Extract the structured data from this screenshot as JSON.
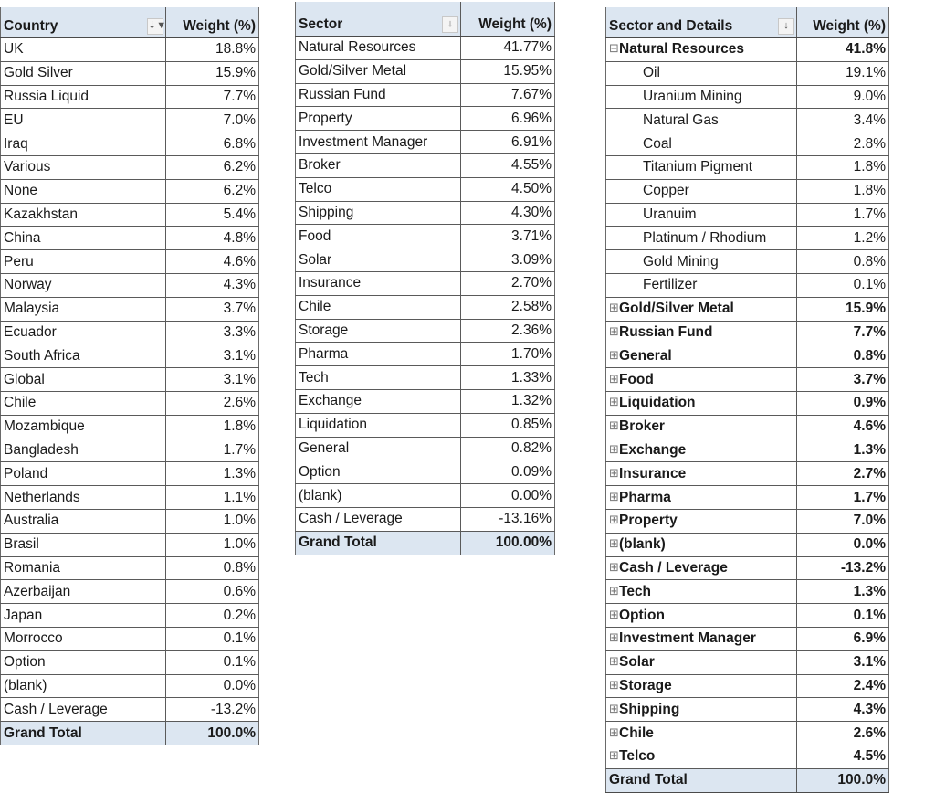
{
  "country_table": {
    "header": {
      "label": "Country",
      "value": "Weight (%)",
      "filter_icon": "filter-sort-icon"
    },
    "rows": [
      {
        "label": "UK",
        "value": "18.8%"
      },
      {
        "label": "Gold Silver",
        "value": "15.9%"
      },
      {
        "label": "Russia Liquid",
        "value": "7.7%"
      },
      {
        "label": "EU",
        "value": "7.0%"
      },
      {
        "label": "Iraq",
        "value": "6.8%"
      },
      {
        "label": "Various",
        "value": "6.2%"
      },
      {
        "label": "None",
        "value": "6.2%"
      },
      {
        "label": "Kazakhstan",
        "value": "5.4%"
      },
      {
        "label": "China",
        "value": "4.8%"
      },
      {
        "label": "Peru",
        "value": "4.6%"
      },
      {
        "label": "Norway",
        "value": "4.3%"
      },
      {
        "label": "Malaysia",
        "value": "3.7%"
      },
      {
        "label": "Ecuador",
        "value": "3.3%"
      },
      {
        "label": "South Africa",
        "value": "3.1%"
      },
      {
        "label": "Global",
        "value": "3.1%"
      },
      {
        "label": "Chile",
        "value": "2.6%"
      },
      {
        "label": "Mozambique",
        "value": "1.8%"
      },
      {
        "label": "Bangladesh",
        "value": "1.7%"
      },
      {
        "label": "Poland",
        "value": "1.3%"
      },
      {
        "label": "Netherlands",
        "value": "1.1%"
      },
      {
        "label": "Australia",
        "value": "1.0%"
      },
      {
        "label": "Brasil",
        "value": "1.0%"
      },
      {
        "label": "Romania",
        "value": "0.8%"
      },
      {
        "label": "Azerbaijan",
        "value": "0.6%"
      },
      {
        "label": "Japan",
        "value": "0.2%"
      },
      {
        "label": "Morrocco",
        "value": "0.1%"
      },
      {
        "label": "Option",
        "value": "0.1%"
      },
      {
        "label": "(blank)",
        "value": "0.0%"
      },
      {
        "label": "Cash / Leverage",
        "value": "-13.2%"
      }
    ],
    "total": {
      "label": "Grand Total",
      "value": "100.0%"
    }
  },
  "sector_table": {
    "header": {
      "label": "Sector",
      "value": "Weight (%)",
      "filter_icon": "sort-descending-icon"
    },
    "rows": [
      {
        "label": "Natural Resources",
        "value": "41.77%"
      },
      {
        "label": "Gold/Silver Metal",
        "value": "15.95%"
      },
      {
        "label": "Russian Fund",
        "value": "7.67%"
      },
      {
        "label": "Property",
        "value": "6.96%"
      },
      {
        "label": "Investment Manager",
        "value": "6.91%"
      },
      {
        "label": "Broker",
        "value": "4.55%"
      },
      {
        "label": "Telco",
        "value": "4.50%"
      },
      {
        "label": "Shipping",
        "value": "4.30%"
      },
      {
        "label": "Food",
        "value": "3.71%"
      },
      {
        "label": "Solar",
        "value": "3.09%"
      },
      {
        "label": "Insurance",
        "value": "2.70%"
      },
      {
        "label": "Chile",
        "value": "2.58%"
      },
      {
        "label": "Storage",
        "value": "2.36%"
      },
      {
        "label": "Pharma",
        "value": "1.70%"
      },
      {
        "label": "Tech",
        "value": "1.33%"
      },
      {
        "label": "Exchange",
        "value": "1.32%"
      },
      {
        "label": "Liquidation",
        "value": "0.85%"
      },
      {
        "label": "General",
        "value": "0.82%"
      },
      {
        "label": "Option",
        "value": "0.09%"
      },
      {
        "label": "(blank)",
        "value": "0.00%"
      },
      {
        "label": "Cash / Leverage",
        "value": "-13.16%"
      }
    ],
    "total": {
      "label": "Grand Total",
      "value": "100.00%"
    }
  },
  "detail_table": {
    "header": {
      "label": "Sector and Details",
      "value": "Weight (%)",
      "filter_icon": "sort-descending-icon"
    },
    "groups": [
      {
        "label": "Natural Resources",
        "value": "41.8%",
        "expanded": true,
        "children": [
          {
            "label": "Oil",
            "value": "19.1%"
          },
          {
            "label": "Uranium Mining",
            "value": "9.0%"
          },
          {
            "label": "Natural Gas",
            "value": "3.4%"
          },
          {
            "label": "Coal",
            "value": "2.8%"
          },
          {
            "label": "Titanium Pigment",
            "value": "1.8%"
          },
          {
            "label": "Copper",
            "value": "1.8%"
          },
          {
            "label": "Uranuim",
            "value": "1.7%"
          },
          {
            "label": "Platinum / Rhodium",
            "value": "1.2%"
          },
          {
            "label": "Gold Mining",
            "value": "0.8%"
          },
          {
            "label": "Fertilizer",
            "value": "0.1%"
          }
        ]
      },
      {
        "label": "Gold/Silver Metal",
        "value": "15.9%",
        "expanded": false
      },
      {
        "label": "Russian Fund",
        "value": "7.7%",
        "expanded": false
      },
      {
        "label": "General",
        "value": "0.8%",
        "expanded": false
      },
      {
        "label": "Food",
        "value": "3.7%",
        "expanded": false
      },
      {
        "label": "Liquidation",
        "value": "0.9%",
        "expanded": false
      },
      {
        "label": "Broker",
        "value": "4.6%",
        "expanded": false
      },
      {
        "label": "Exchange",
        "value": "1.3%",
        "expanded": false
      },
      {
        "label": "Insurance",
        "value": "2.7%",
        "expanded": false
      },
      {
        "label": "Pharma",
        "value": "1.7%",
        "expanded": false
      },
      {
        "label": "Property",
        "value": "7.0%",
        "expanded": false
      },
      {
        "label": "(blank)",
        "value": "0.0%",
        "expanded": false
      },
      {
        "label": "Cash / Leverage",
        "value": "-13.2%",
        "expanded": false
      },
      {
        "label": "Tech",
        "value": "1.3%",
        "expanded": false
      },
      {
        "label": "Option",
        "value": "0.1%",
        "expanded": false
      },
      {
        "label": "Investment Manager",
        "value": "6.9%",
        "expanded": false
      },
      {
        "label": "Solar",
        "value": "3.1%",
        "expanded": false
      },
      {
        "label": "Storage",
        "value": "2.4%",
        "expanded": false
      },
      {
        "label": "Shipping",
        "value": "4.3%",
        "expanded": false
      },
      {
        "label": "Chile",
        "value": "2.6%",
        "expanded": false
      },
      {
        "label": "Telco",
        "value": "4.5%",
        "expanded": false
      }
    ],
    "total": {
      "label": "Grand Total",
      "value": "100.0%"
    },
    "icons": {
      "expand": "⊞",
      "collapse": "⊟"
    }
  },
  "glyphs": {
    "filter_sort": "⇣▼",
    "sort_desc": "↓"
  }
}
